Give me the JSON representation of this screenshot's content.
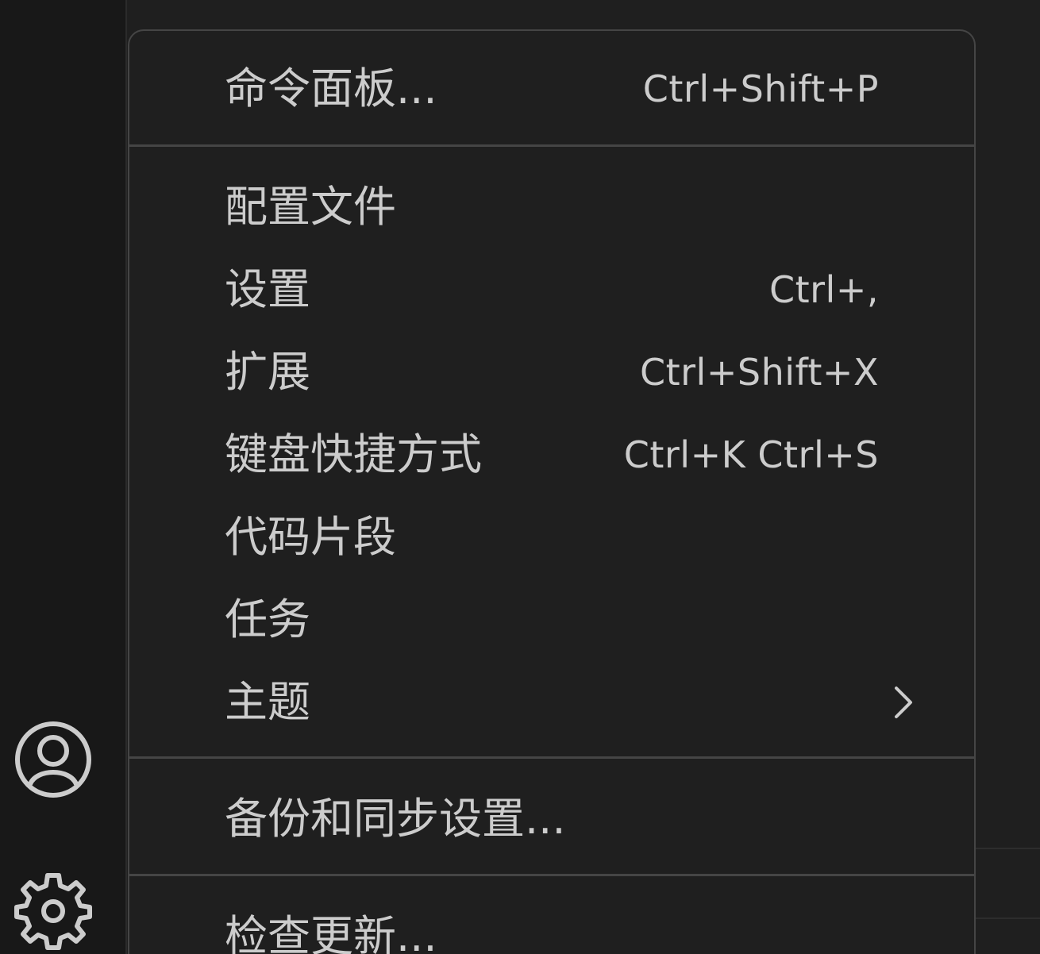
{
  "menu": {
    "command_palette": {
      "label": "命令面板...",
      "shortcut": "Ctrl+Shift+P"
    },
    "profiles": {
      "label": "配置文件"
    },
    "settings": {
      "label": "设置",
      "shortcut": "Ctrl+,"
    },
    "extensions": {
      "label": "扩展",
      "shortcut": "Ctrl+Shift+X"
    },
    "keyboard_shortcuts": {
      "label": "键盘快捷方式",
      "shortcut": "Ctrl+K Ctrl+S"
    },
    "snippets": {
      "label": "代码片段"
    },
    "tasks": {
      "label": "任务"
    },
    "themes": {
      "label": "主题",
      "icon": "chevron-right-icon"
    },
    "backup_sync": {
      "label": "备份和同步设置..."
    },
    "check_updates": {
      "label": "检查更新..."
    }
  },
  "activity_bar": {
    "icons": [
      "account-icon",
      "gear-icon"
    ]
  },
  "colors": {
    "background": "#1f1f1f",
    "activity_bar": "#181818",
    "menu_border": "#454545",
    "text": "#cccccc"
  }
}
